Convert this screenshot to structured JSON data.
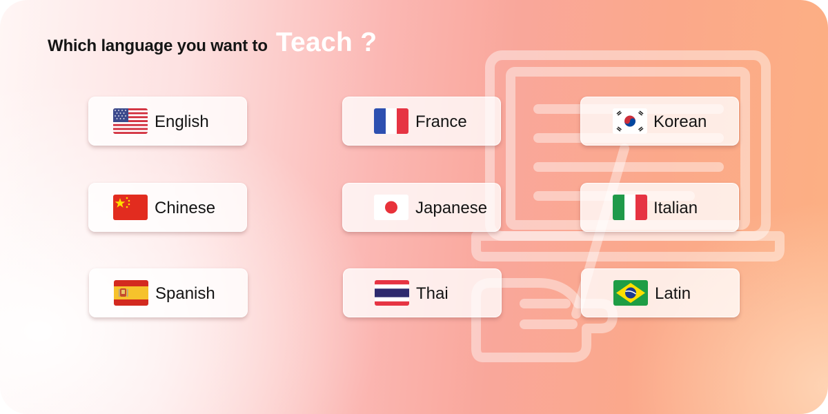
{
  "heading": {
    "question": "Which language you want to",
    "highlight": "Teach ?"
  },
  "colors": {
    "heading_text": "#151515",
    "highlight_text": "#ffffff",
    "button_background": "rgba(255,255,255,0.78)",
    "illustration_stroke": "rgba(255,255,255,0.45)"
  },
  "languages": [
    {
      "label": "English",
      "icon": "us-flag-icon"
    },
    {
      "label": "France",
      "icon": "france-flag-icon"
    },
    {
      "label": "Korean",
      "icon": "korea-flag-icon"
    },
    {
      "label": "Chinese",
      "icon": "china-flag-icon"
    },
    {
      "label": "Japanese",
      "icon": "japan-flag-icon"
    },
    {
      "label": "Italian",
      "icon": "italy-flag-icon"
    },
    {
      "label": "Spanish",
      "icon": "spain-flag-icon"
    },
    {
      "label": "Thai",
      "icon": "thailand-flag-icon"
    },
    {
      "label": "Latin",
      "icon": "brazil-flag-icon"
    }
  ]
}
